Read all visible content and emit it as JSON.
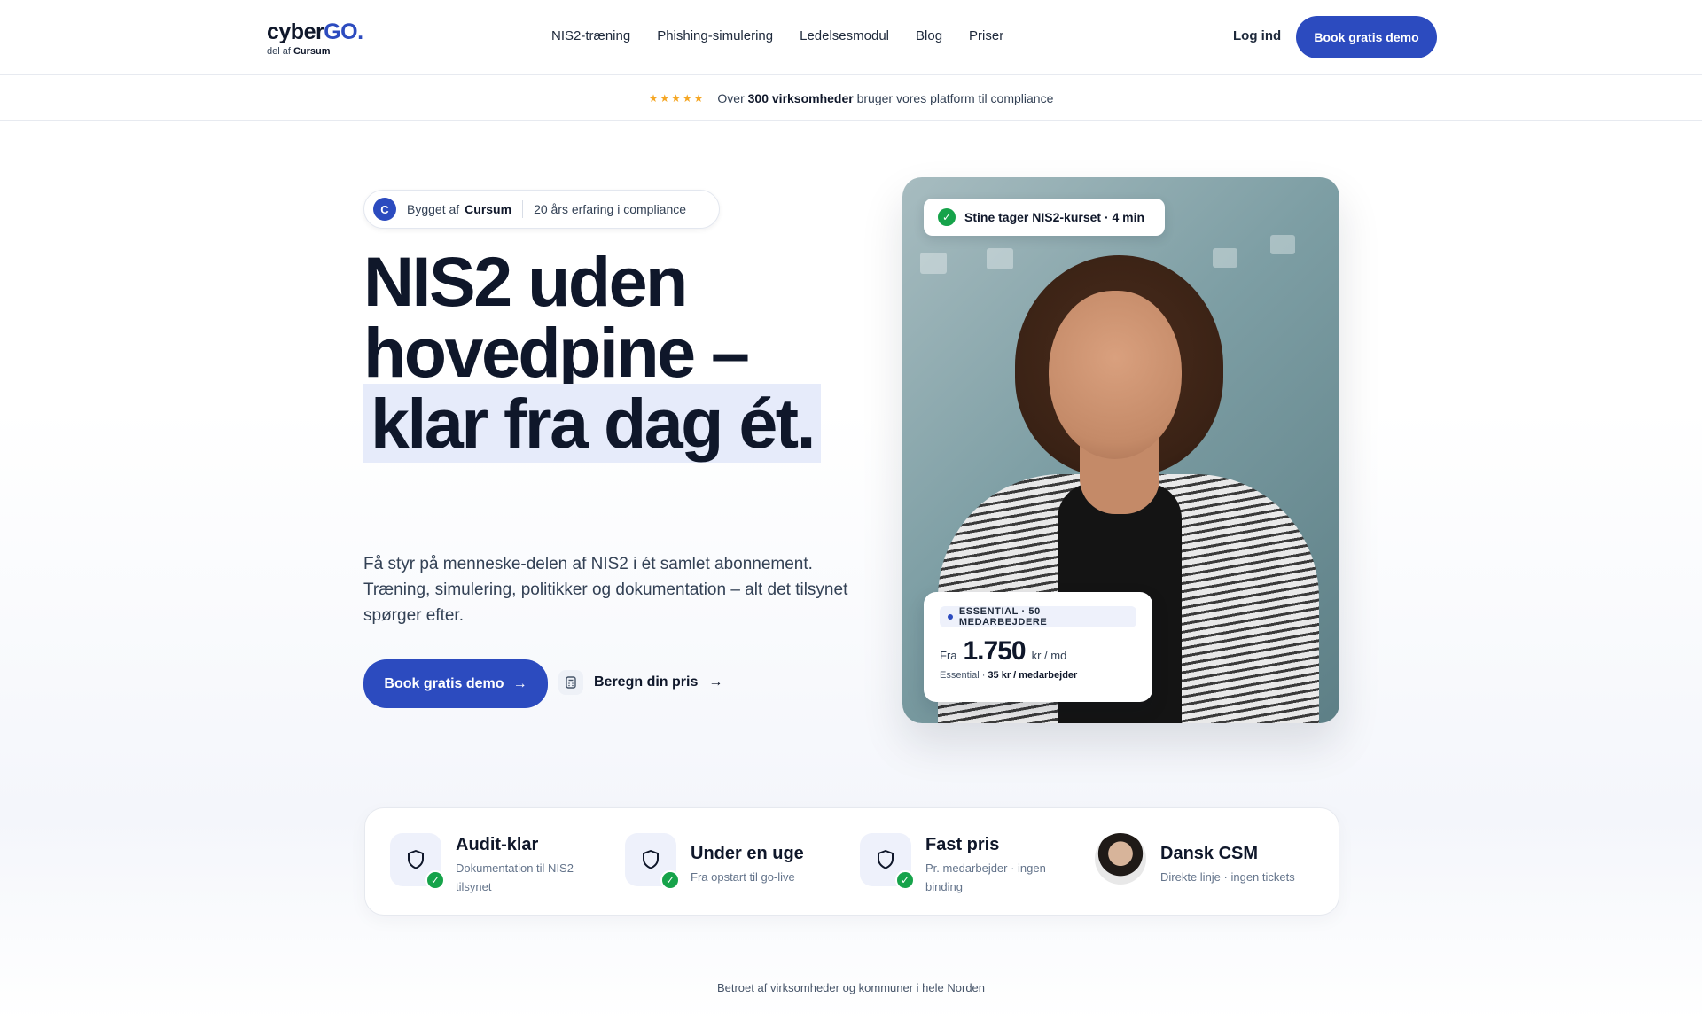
{
  "header": {
    "logo_main": "cyber",
    "logo_go": "GO.",
    "logo_sub_prefix": "del af",
    "logo_sub_brand": "Cursum",
    "nav": [
      "NIS2-træning",
      "Phishing-simulering",
      "Ledelsesmodul",
      "Blog",
      "Priser"
    ],
    "login_label": "Log ind",
    "demo_label": "Book gratis demo"
  },
  "trustbar": {
    "stars": "★★★★★",
    "text_prefix": "Over",
    "text_bold": "300 virksomheder",
    "text_suffix": "bruger vores platform til compliance"
  },
  "hero": {
    "badge_initial": "C",
    "badge_prefix": "Bygget af",
    "badge_brand": "Cursum",
    "badge_note": "20 års erfaring i compliance",
    "headline_part1": "NIS2 uden hovedpine –",
    "headline_highlight": "klar fra dag ét.",
    "lead": "Få styr på menneske-delen af NIS2 i ét samlet abonnement. Træning, simulering, politikker og dokumentation – alt det tilsynet spørger efter.",
    "cta_label": "Book gratis demo",
    "cta_arrow": "→",
    "calc_label": "Beregn din pris",
    "calc_arrow": "→"
  },
  "photo_card": {
    "tag_check": "✓",
    "tag_text": "Stine tager NIS2-kurset · 4 min",
    "price_pill": "ESSENTIAL · 50 MEDARBEJDERE",
    "price_from": "Fra",
    "price_amount": "1.750",
    "price_unit": "kr / md",
    "price_note_prefix": "Essential ·",
    "price_note_bold": "35 kr / medarbejder"
  },
  "features": [
    {
      "title": "Audit-klar",
      "sub": "Dokumentation til NIS2-tilsynet",
      "icon": "shield-icon"
    },
    {
      "title": "Under en uge",
      "sub": "Fra opstart til go-live",
      "icon": "shield-icon"
    },
    {
      "title": "Fast pris",
      "sub": "Pr. medarbejder · ingen binding",
      "icon": "shield-icon"
    },
    {
      "title": "Dansk CSM",
      "sub": "Direkte linje · ingen tickets",
      "icon": "avatar"
    }
  ],
  "footer_note": "Betroet af virksomheder og kommuner i hele Norden",
  "colors": {
    "accent": "#2c4bbf",
    "success": "#16a34a",
    "star": "#f5a623",
    "highlight": "#e6ebfa"
  }
}
